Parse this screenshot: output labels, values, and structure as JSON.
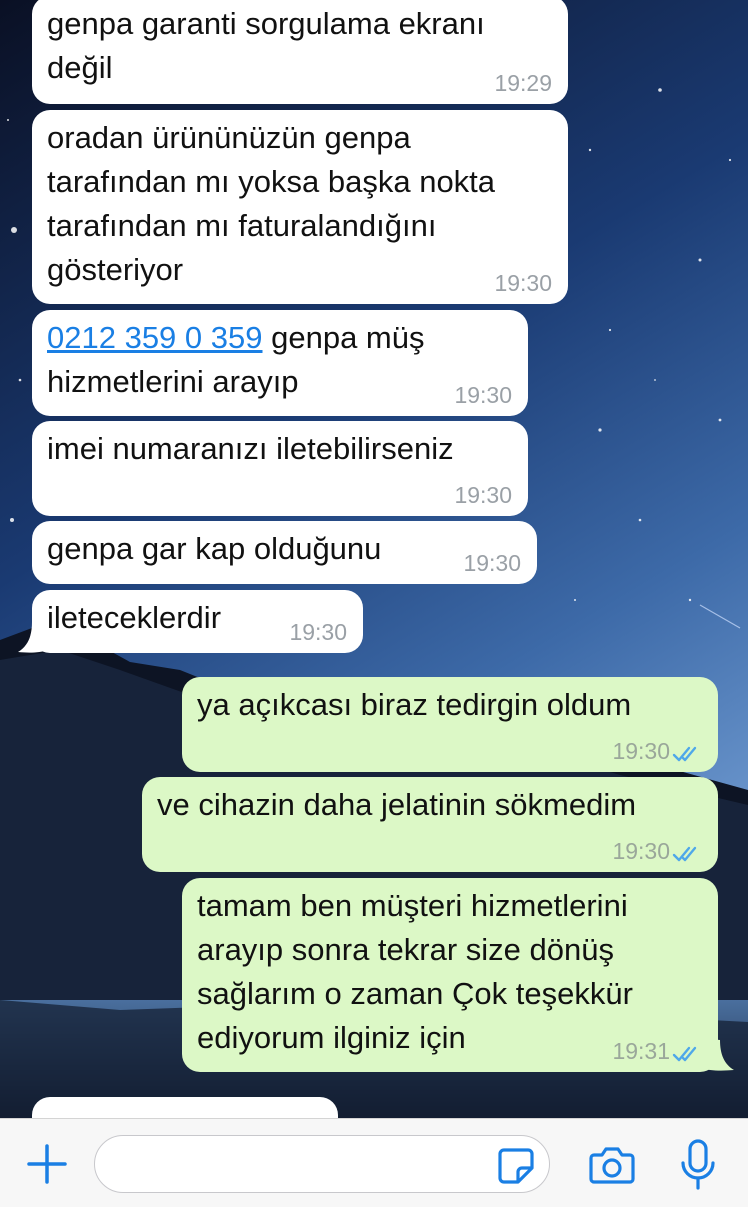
{
  "colors": {
    "incoming_bubble": "#ffffff",
    "outgoing_bubble": "#dcf8c6",
    "link": "#1a7fe4",
    "read_ticks": "#4fa8e9",
    "composer_icons": "#1a7fe4"
  },
  "messages": [
    {
      "direction": "incoming",
      "text": "genpa garanti sorgulama ekranı değil",
      "time": "19:29"
    },
    {
      "direction": "incoming",
      "text": "oradan ürününüzün genpa tarafından mı yoksa başka nokta tarafından mı faturalandığını gösteriyor",
      "time": "19:30"
    },
    {
      "direction": "incoming",
      "link": "0212 359 0 359",
      "text": " genpa müş hizmetlerini arayıp",
      "time": "19:30"
    },
    {
      "direction": "incoming",
      "text": "imei numaranızı iletebilirseniz",
      "time": "19:30"
    },
    {
      "direction": "incoming",
      "text": "genpa gar kap olduğunu",
      "time": "19:30"
    },
    {
      "direction": "incoming",
      "text": "ileteceklerdir",
      "time": "19:30"
    },
    {
      "direction": "outgoing",
      "text": "ya açıkcası biraz tedirgin oldum",
      "time": "19:30",
      "status": "read-double-check-icon"
    },
    {
      "direction": "outgoing",
      "text": "ve cihazin daha jelatinin sökmedim",
      "time": "19:30",
      "status": "read-double-check-icon"
    },
    {
      "direction": "outgoing",
      "text": "tamam ben müşteri hizmetlerini arayıp sonra tekrar size dönüş sağlarım o zaman Çok teşekkür ediyorum ilginiz için",
      "time": "19:31",
      "status": "read-double-check-icon"
    }
  ],
  "composer": {
    "input_value": "",
    "icons": [
      "plus-icon",
      "sticker-icon",
      "camera-icon",
      "microphone-icon"
    ]
  }
}
